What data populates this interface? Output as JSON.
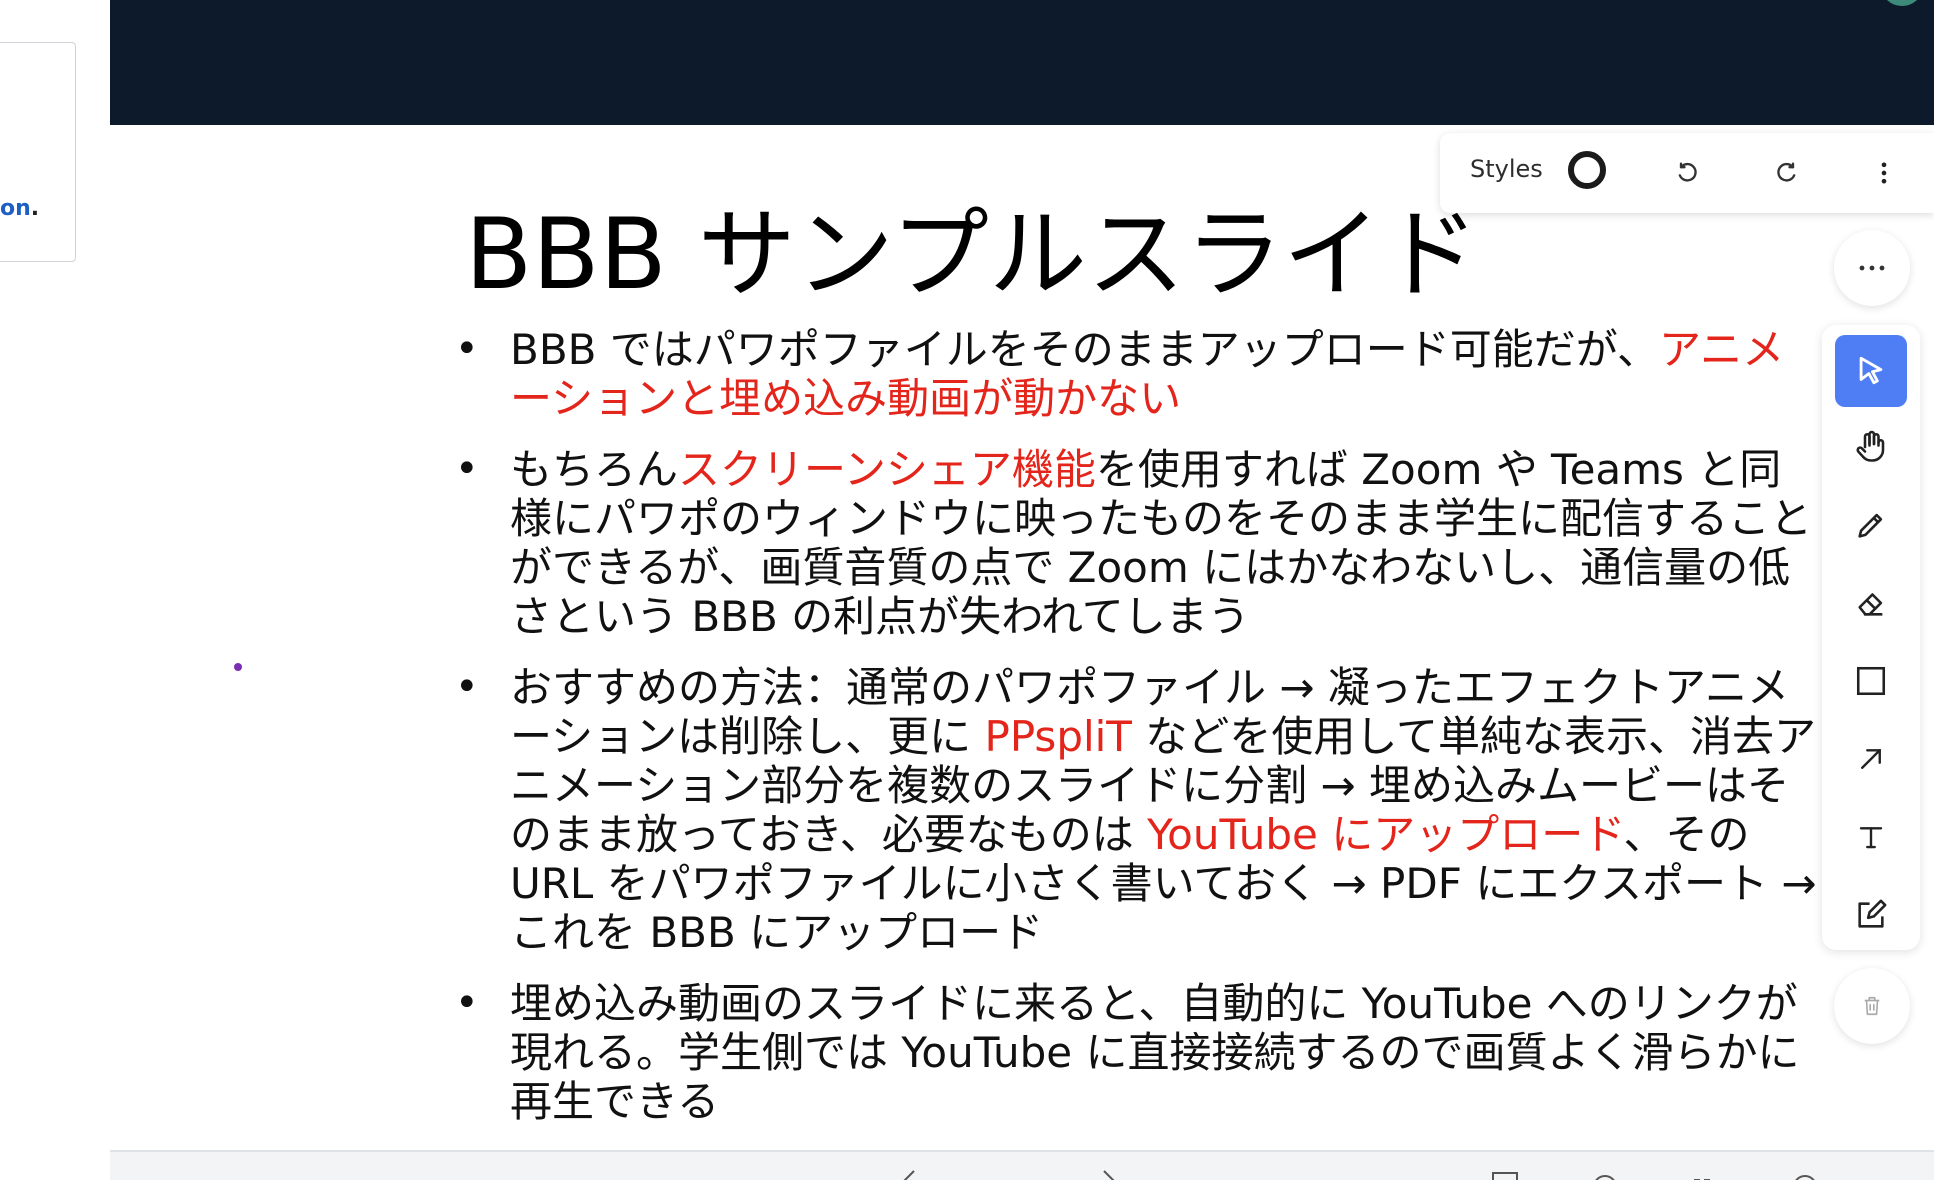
{
  "left_panel": {
    "link_text": "on",
    "link_suffix": "."
  },
  "slide": {
    "title": "BBB サンプルスライド",
    "bullets": [
      {
        "parts": [
          {
            "text": "BBB ではパワポファイルをそのままアップロード可能だが、",
            "red": false
          },
          {
            "text": "アニメーションと埋め込み動画が動かない",
            "red": true
          }
        ]
      },
      {
        "parts": [
          {
            "text": "もちろん",
            "red": false
          },
          {
            "text": "スクリーンシェア機能",
            "red": true
          },
          {
            "text": "を使用すれば Zoom や Teams と同様にパワポのウィンドウに映ったものをそのまま学生に配信することができるが、画質音質の点で Zoom にはかなわないし、通信量の低さという BBB の利点が失われてしまう",
            "red": false
          }
        ]
      },
      {
        "parts": [
          {
            "text": "おすすめの方法：通常のパワポファイル → 凝ったエフェクトアニメーションは削除し、更に ",
            "red": false
          },
          {
            "text": "PPspliT",
            "red": true
          },
          {
            "text": " などを使用して単純な表示、消去アニメーション部分を複数のスライドに分割 → 埋め込みムービーはそのまま放っておき、必要なものは ",
            "red": false
          },
          {
            "text": "YouTube にアップロード",
            "red": true
          },
          {
            "text": "、その URL をパワポファイルに小さく書いておく → PDF にエクスポート → これを BBB にアップロード",
            "red": false
          }
        ]
      },
      {
        "parts": [
          {
            "text": "埋め込み動画のスライドに来ると、自動的に YouTube へのリンクが現れる。学生側では YouTube に直接接続するので画質よく滑らかに再生できる",
            "red": false
          }
        ]
      }
    ]
  },
  "toolbar": {
    "styles_label": "Styles"
  },
  "colors": {
    "header_bg": "#0d1a2c",
    "accent_red": "#e3251b",
    "active_tool": "#4f7df3"
  },
  "icons": {
    "undo": "undo-icon",
    "redo": "redo-icon",
    "menu": "kebab-menu-icon",
    "more": "more-horizontal-icon",
    "select": "cursor-icon",
    "hand": "hand-icon",
    "pencil": "pencil-icon",
    "eraser": "eraser-icon",
    "rectangle": "rectangle-icon",
    "arrow": "arrow-icon",
    "text": "text-icon",
    "note": "note-edit-icon",
    "trash": "trash-icon"
  }
}
